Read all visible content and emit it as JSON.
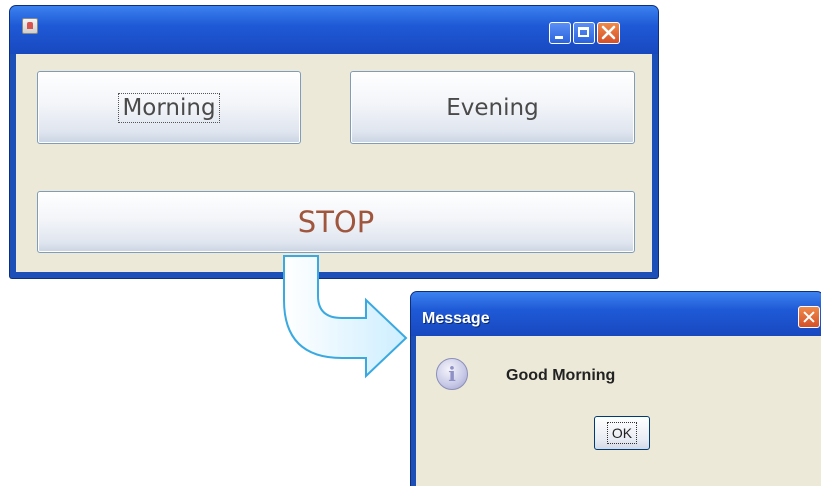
{
  "main_window": {
    "buttons": {
      "morning_label": "Morning",
      "evening_label": "Evening",
      "stop_label": "STOP"
    }
  },
  "dialog": {
    "title": "Message",
    "message": "Good Morning",
    "ok_label": "OK",
    "icon": "info-icon"
  },
  "colors": {
    "titlebar": "#1f5ad6",
    "stop_text": "#a0553d",
    "arrow_fill": "#e9f7ff",
    "arrow_stroke": "#3aa9e0"
  }
}
